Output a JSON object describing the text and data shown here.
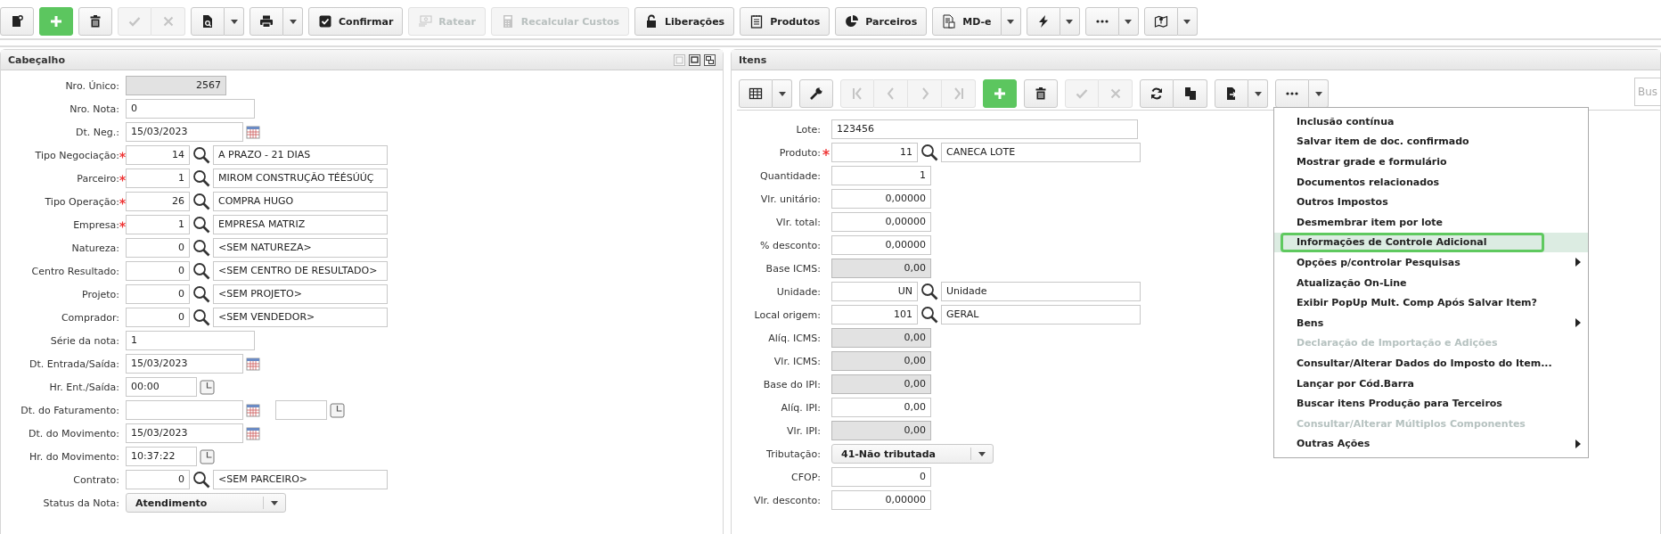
{
  "toolbar": [
    {
      "kind": "icon",
      "disabled": false
    },
    {
      "kind": "add",
      "disabled": false
    },
    {
      "kind": "icon",
      "disabled": false
    },
    {
      "kind": "group",
      "disabled": true
    },
    {
      "kind": "split",
      "disabled": false
    },
    {
      "kind": "split",
      "disabled": false
    },
    {
      "kind": "text",
      "label": "Confirmar",
      "disabled": false
    },
    {
      "kind": "text",
      "label": "Ratear",
      "disabled": true
    },
    {
      "kind": "text",
      "label": "Recalcular Custos",
      "disabled": true
    },
    {
      "kind": "text",
      "label": "Liberações",
      "disabled": false
    },
    {
      "kind": "text",
      "label": "Produtos",
      "disabled": false
    },
    {
      "kind": "text",
      "label": "Parceiros",
      "disabled": false
    },
    {
      "kind": "split",
      "label": "MD-e",
      "disabled": false
    },
    {
      "kind": "split",
      "disabled": false
    },
    {
      "kind": "split",
      "disabled": false
    },
    {
      "kind": "split",
      "disabled": false
    }
  ],
  "header_panel": {
    "title": "Cabeçalho",
    "fields": [
      {
        "label": "Nro. Único:",
        "kind": "number",
        "value": "2567",
        "required": false,
        "readonly": true
      },
      {
        "label": "Nro. Nota:",
        "kind": "text",
        "value": "0",
        "required": false,
        "readonly": false
      },
      {
        "label": "Dt. Neg.:",
        "kind": "date",
        "value": "15/03/2023",
        "required": false,
        "readonly": false
      },
      {
        "label": "Tipo Negociação:",
        "kind": "lookup",
        "value": "14",
        "description": "A PRAZO - 21 DIAS",
        "required": true,
        "readonly": false
      },
      {
        "label": "Parceiro:",
        "kind": "lookup",
        "value": "1",
        "description": "MIROM CONSTRUÇÃO TÉÉSÚÚÇ",
        "required": true,
        "readonly": false
      },
      {
        "label": "Tipo Operação:",
        "kind": "lookup",
        "value": "26",
        "description": "COMPRA HUGO",
        "required": true,
        "readonly": false
      },
      {
        "label": "Empresa:",
        "kind": "lookup",
        "value": "1",
        "description": "EMPRESA MATRIZ",
        "required": true,
        "readonly": false
      },
      {
        "label": "Natureza:",
        "kind": "lookup",
        "value": "0",
        "description": "<SEM NATUREZA>",
        "required": false,
        "readonly": false
      },
      {
        "label": "Centro Resultado:",
        "kind": "lookup",
        "value": "0",
        "description": "<SEM CENTRO DE RESULTADO>",
        "required": false,
        "readonly": false
      },
      {
        "label": "Projeto:",
        "kind": "lookup",
        "value": "0",
        "description": "<SEM PROJETO>",
        "required": false,
        "readonly": false
      },
      {
        "label": "Comprador:",
        "kind": "lookup",
        "value": "0",
        "description": "<SEM VENDEDOR>",
        "required": false,
        "readonly": false
      },
      {
        "label": "Série da nota:",
        "kind": "text",
        "value": "1",
        "required": false,
        "readonly": false
      },
      {
        "label": "Dt. Entrada/Saída:",
        "kind": "date",
        "value": "15/03/2023",
        "required": false,
        "readonly": false
      },
      {
        "label": "Hr. Ent./Saída:",
        "kind": "time",
        "value": "00:00",
        "required": false,
        "readonly": false
      },
      {
        "label": "Dt. do Faturamento:",
        "kind": "datetime",
        "required": false,
        "readonly": false
      },
      {
        "label": "Dt. do Movimento:",
        "kind": "date",
        "value": "15/03/2023",
        "required": false,
        "readonly": false
      },
      {
        "label": "Hr. do Movimento:",
        "kind": "time",
        "value": "10:37:22",
        "required": false,
        "readonly": false
      },
      {
        "label": "Contrato:",
        "kind": "lookup",
        "value": "0",
        "description": "<SEM PARCEIRO>",
        "required": false,
        "readonly": false
      },
      {
        "label": "Status da Nota:",
        "kind": "select",
        "value": "Atendimento",
        "required": false,
        "readonly": false
      }
    ]
  },
  "items_panel": {
    "title": "Itens",
    "toolbar": [
      {
        "kind": "split",
        "disabled": false
      },
      {
        "kind": "icon",
        "disabled": false
      },
      {
        "kind": "group",
        "disabled": true
      },
      {
        "kind": "add",
        "disabled": false
      },
      {
        "kind": "icon",
        "disabled": false
      },
      {
        "kind": "group",
        "disabled": true
      },
      {
        "kind": "group",
        "disabled": false
      },
      {
        "kind": "split",
        "disabled": false
      },
      {
        "kind": "split",
        "disabled": false
      }
    ],
    "search": {
      "placeholder": "Bus"
    },
    "fields": [
      {
        "label": "Lote:",
        "kind": "text",
        "value": "123456",
        "required": false,
        "readonly": false
      },
      {
        "label": "Produto:",
        "kind": "lookup",
        "value": "11",
        "description": "CANECA LOTE",
        "required": true,
        "readonly": false
      },
      {
        "label": "Quantidade:",
        "kind": "number",
        "value": "1",
        "required": false,
        "readonly": false
      },
      {
        "label": "Vlr. unitário:",
        "kind": "number",
        "value": "0,00000",
        "required": false,
        "readonly": false
      },
      {
        "label": "Vlr. total:",
        "kind": "number",
        "value": "0,00000",
        "required": false,
        "readonly": false
      },
      {
        "label": "% desconto:",
        "kind": "number",
        "value": "0,00000",
        "required": false,
        "readonly": false
      },
      {
        "label": "Base ICMS:",
        "kind": "number",
        "value": "0,00",
        "required": false,
        "readonly": true
      },
      {
        "label": "Unidade:",
        "kind": "lookup",
        "value": "UN",
        "description": "Unidade",
        "required": false,
        "readonly": false
      },
      {
        "label": "Local origem:",
        "kind": "lookup",
        "value": "101",
        "description": "GERAL",
        "required": false,
        "readonly": false
      },
      {
        "label": "Alíq. ICMS:",
        "kind": "number",
        "value": "0,00",
        "required": false,
        "readonly": true
      },
      {
        "label": "Vlr. ICMS:",
        "kind": "number",
        "value": "0,00",
        "required": false,
        "readonly": true
      },
      {
        "label": "Base do IPI:",
        "kind": "number",
        "value": "0,00",
        "required": false,
        "readonly": true
      },
      {
        "label": "Alíq. IPI:",
        "kind": "number",
        "value": "0,00",
        "required": false,
        "readonly": false
      },
      {
        "label": "Vlr. IPI:",
        "kind": "number",
        "value": "0,00",
        "required": false,
        "readonly": true
      },
      {
        "label": "Tributação:",
        "kind": "select",
        "value": "41-Não tributada",
        "required": false,
        "readonly": false
      },
      {
        "label": "CFOP:",
        "kind": "number",
        "value": "0",
        "required": false,
        "readonly": false
      },
      {
        "label": "Vlr. desconto:",
        "kind": "number",
        "value": "0,00000",
        "required": false,
        "readonly": false
      }
    ],
    "menu": [
      {
        "label": "Inclusão contínua",
        "disabled": false,
        "submenu": false,
        "highlighted": false
      },
      {
        "label": "Salvar item de doc. confirmado",
        "disabled": false,
        "submenu": false,
        "highlighted": false
      },
      {
        "label": "Mostrar grade e formulário",
        "disabled": false,
        "submenu": false,
        "highlighted": false
      },
      {
        "label": "Documentos relacionados",
        "disabled": false,
        "submenu": false,
        "highlighted": false
      },
      {
        "label": "Outros Impostos",
        "disabled": false,
        "submenu": false,
        "highlighted": false
      },
      {
        "label": "Desmembrar item por lote",
        "disabled": false,
        "submenu": false,
        "highlighted": false
      },
      {
        "label": "Informações de Controle Adicional",
        "disabled": false,
        "submenu": false,
        "highlighted": true
      },
      {
        "label": "Opções p/controlar Pesquisas",
        "disabled": false,
        "submenu": true,
        "highlighted": false
      },
      {
        "label": "Atualização On-Line",
        "disabled": false,
        "submenu": false,
        "highlighted": false
      },
      {
        "label": "Exibir PopUp Mult. Comp Após Salvar Item?",
        "disabled": false,
        "submenu": false,
        "highlighted": false
      },
      {
        "label": "Bens",
        "disabled": false,
        "submenu": true,
        "highlighted": false
      },
      {
        "label": "Declaração de Importação e Adições",
        "disabled": true,
        "submenu": false,
        "highlighted": false
      },
      {
        "label": "Consultar/Alterar Dados do Imposto do Item...",
        "disabled": false,
        "submenu": false,
        "highlighted": false
      },
      {
        "label": "Lançar por Cód.Barra",
        "disabled": false,
        "submenu": false,
        "highlighted": false
      },
      {
        "label": "Buscar itens Produção para Terceiros",
        "disabled": false,
        "submenu": false,
        "highlighted": false
      },
      {
        "label": "Consultar/Alterar Múltiplos Componentes",
        "disabled": true,
        "submenu": false,
        "highlighted": false
      },
      {
        "label": "Outras Ações",
        "disabled": false,
        "submenu": true,
        "highlighted": false
      }
    ]
  }
}
